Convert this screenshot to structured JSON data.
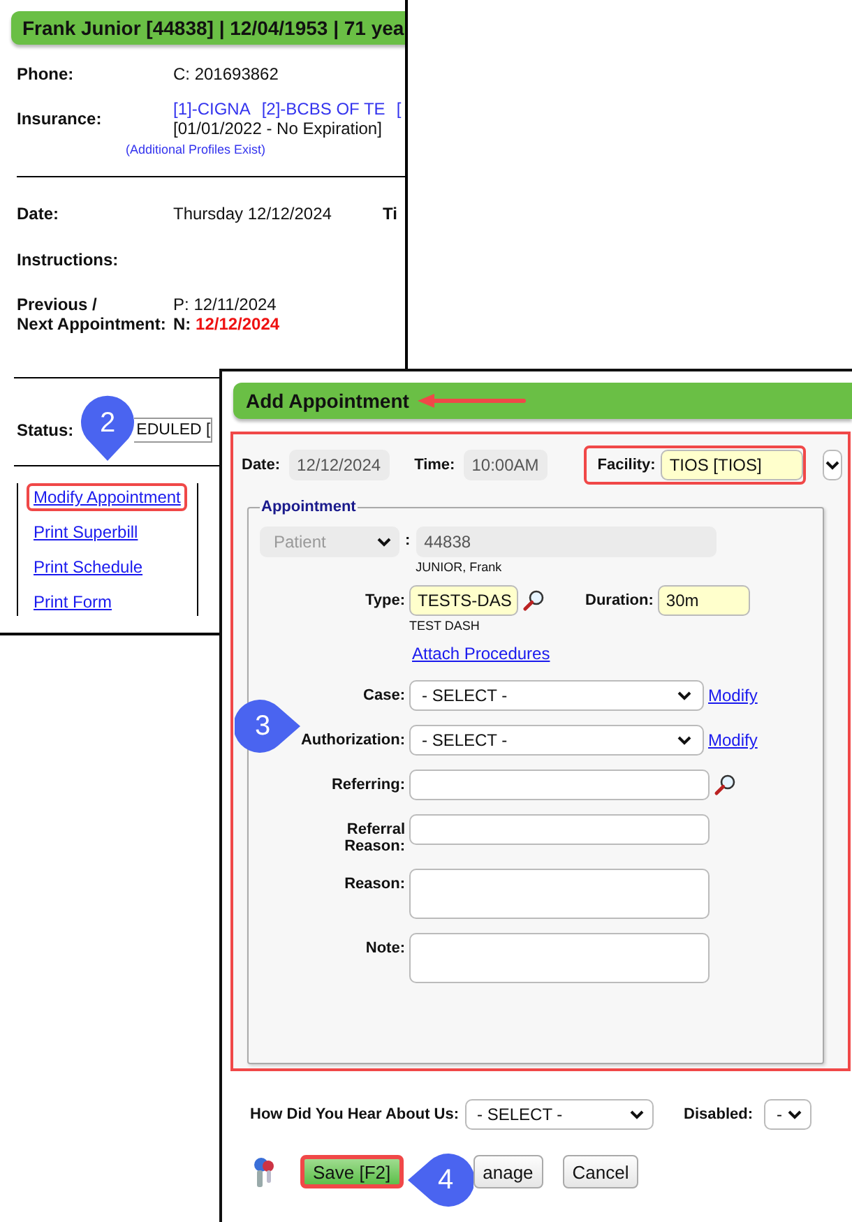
{
  "patient_window": {
    "title": "Frank Junior [44838] | 12/04/1953 | 71 yea",
    "phone": {
      "label": "Phone:",
      "value": "C: 201693862"
    },
    "insurance": {
      "label": "Insurance:",
      "plans": [
        "[1]-CIGNA",
        "[2]-BCBS OF TE",
        "["
      ],
      "period": "[01/01/2022 - No Expiration]",
      "note": "(Additional Profiles Exist)"
    },
    "date": {
      "label": "Date:",
      "value": "Thursday 12/12/2024"
    },
    "time_label": "Ti",
    "instructions": {
      "label": "Instructions:"
    },
    "appointments": {
      "label_lines": [
        "Previous /",
        "Next Appointment:"
      ],
      "previous": {
        "prefix": "P:",
        "date": "12/11/2024"
      },
      "next": {
        "prefix": "N:",
        "date": "12/12/2024"
      }
    },
    "status": {
      "label": "Status:",
      "value": "EDULED ["
    },
    "links": [
      {
        "label": "Modify Appointment",
        "highlighted": true
      },
      {
        "label": "Print Superbill",
        "highlighted": false
      },
      {
        "label": "Print Schedule",
        "highlighted": false
      },
      {
        "label": "Print Form",
        "highlighted": false
      }
    ]
  },
  "add_appointment": {
    "title": "Add Appointment",
    "highlighted": true,
    "date": {
      "label": "Date:",
      "value": "12/12/2024"
    },
    "time": {
      "label": "Time:",
      "value": "10:00AM"
    },
    "facility": {
      "label": "Facility:",
      "value": "TIOS [TIOS]",
      "highlighted": true
    },
    "fieldset": "Appointment",
    "patient": {
      "selector": "Patient",
      "separator": ":",
      "value": "44838",
      "name": "JUNIOR, Frank"
    },
    "type": {
      "label": "Type:",
      "value": "TESTS-DAS",
      "description": "TEST DASH"
    },
    "duration": {
      "label": "Duration:",
      "value": "30m"
    },
    "attach_link": "Attach Procedures",
    "fields": [
      {
        "kind": "select",
        "label": "Case:",
        "value": "- SELECT -",
        "link": "Modify"
      },
      {
        "kind": "select",
        "label": "Authorization:",
        "value": "- SELECT -",
        "link": "Modify"
      },
      {
        "kind": "lookup",
        "label": "Referring:"
      },
      {
        "kind": "input",
        "label": "Referral Reason:"
      },
      {
        "kind": "textarea",
        "label": "Reason:"
      },
      {
        "kind": "textarea",
        "label": "Note:"
      }
    ],
    "heard_about": {
      "label": "How Did You Hear About Us:",
      "value": "- SELECT -"
    },
    "disabled": {
      "label": "Disabled:",
      "value": "-"
    },
    "buttons": [
      {
        "kind": "primary",
        "label": "Save [F2]",
        "highlighted": true
      },
      {
        "kind": "plain",
        "label": "anage",
        "highlighted": false
      },
      {
        "kind": "plain",
        "label": "Cancel",
        "highlighted": false
      }
    ]
  },
  "annotations": [
    {
      "number": "2",
      "kind": "down"
    },
    {
      "number": "3",
      "kind": "right"
    },
    {
      "number": "4",
      "kind": "left"
    }
  ]
}
